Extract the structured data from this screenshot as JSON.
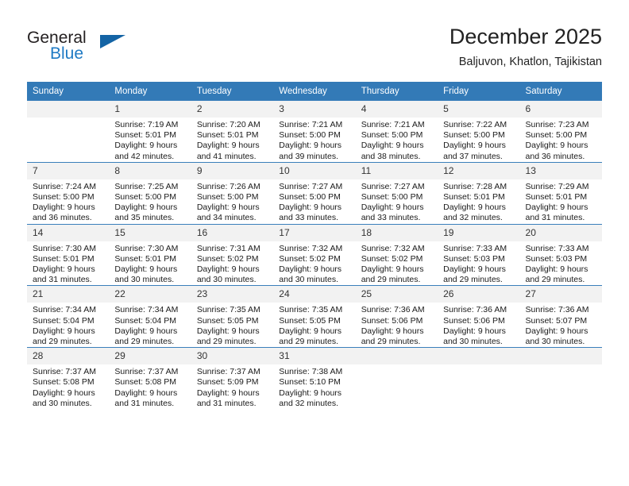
{
  "brand": {
    "name_part1": "General",
    "name_part2": "Blue",
    "logo_icon": "triangle-logo-icon",
    "color_dark": "#231f20",
    "color_blue": "#1f7ac4"
  },
  "header": {
    "title": "December 2025",
    "subtitle": "Baljuvon, Khatlon, Tajikistan"
  },
  "theme": {
    "header_row_bg": "#337ab7",
    "daynum_bg": "#f2f2f2",
    "grid_line": "#3a7fbb"
  },
  "calendar": {
    "weekdays": [
      "Sunday",
      "Monday",
      "Tuesday",
      "Wednesday",
      "Thursday",
      "Friday",
      "Saturday"
    ],
    "weeks": [
      [
        {
          "day": "",
          "sunrise": "",
          "sunset": "",
          "daylight1": "",
          "daylight2": ""
        },
        {
          "day": "1",
          "sunrise": "Sunrise: 7:19 AM",
          "sunset": "Sunset: 5:01 PM",
          "daylight1": "Daylight: 9 hours",
          "daylight2": "and 42 minutes."
        },
        {
          "day": "2",
          "sunrise": "Sunrise: 7:20 AM",
          "sunset": "Sunset: 5:01 PM",
          "daylight1": "Daylight: 9 hours",
          "daylight2": "and 41 minutes."
        },
        {
          "day": "3",
          "sunrise": "Sunrise: 7:21 AM",
          "sunset": "Sunset: 5:00 PM",
          "daylight1": "Daylight: 9 hours",
          "daylight2": "and 39 minutes."
        },
        {
          "day": "4",
          "sunrise": "Sunrise: 7:21 AM",
          "sunset": "Sunset: 5:00 PM",
          "daylight1": "Daylight: 9 hours",
          "daylight2": "and 38 minutes."
        },
        {
          "day": "5",
          "sunrise": "Sunrise: 7:22 AM",
          "sunset": "Sunset: 5:00 PM",
          "daylight1": "Daylight: 9 hours",
          "daylight2": "and 37 minutes."
        },
        {
          "day": "6",
          "sunrise": "Sunrise: 7:23 AM",
          "sunset": "Sunset: 5:00 PM",
          "daylight1": "Daylight: 9 hours",
          "daylight2": "and 36 minutes."
        }
      ],
      [
        {
          "day": "7",
          "sunrise": "Sunrise: 7:24 AM",
          "sunset": "Sunset: 5:00 PM",
          "daylight1": "Daylight: 9 hours",
          "daylight2": "and 36 minutes."
        },
        {
          "day": "8",
          "sunrise": "Sunrise: 7:25 AM",
          "sunset": "Sunset: 5:00 PM",
          "daylight1": "Daylight: 9 hours",
          "daylight2": "and 35 minutes."
        },
        {
          "day": "9",
          "sunrise": "Sunrise: 7:26 AM",
          "sunset": "Sunset: 5:00 PM",
          "daylight1": "Daylight: 9 hours",
          "daylight2": "and 34 minutes."
        },
        {
          "day": "10",
          "sunrise": "Sunrise: 7:27 AM",
          "sunset": "Sunset: 5:00 PM",
          "daylight1": "Daylight: 9 hours",
          "daylight2": "and 33 minutes."
        },
        {
          "day": "11",
          "sunrise": "Sunrise: 7:27 AM",
          "sunset": "Sunset: 5:00 PM",
          "daylight1": "Daylight: 9 hours",
          "daylight2": "and 33 minutes."
        },
        {
          "day": "12",
          "sunrise": "Sunrise: 7:28 AM",
          "sunset": "Sunset: 5:01 PM",
          "daylight1": "Daylight: 9 hours",
          "daylight2": "and 32 minutes."
        },
        {
          "day": "13",
          "sunrise": "Sunrise: 7:29 AM",
          "sunset": "Sunset: 5:01 PM",
          "daylight1": "Daylight: 9 hours",
          "daylight2": "and 31 minutes."
        }
      ],
      [
        {
          "day": "14",
          "sunrise": "Sunrise: 7:30 AM",
          "sunset": "Sunset: 5:01 PM",
          "daylight1": "Daylight: 9 hours",
          "daylight2": "and 31 minutes."
        },
        {
          "day": "15",
          "sunrise": "Sunrise: 7:30 AM",
          "sunset": "Sunset: 5:01 PM",
          "daylight1": "Daylight: 9 hours",
          "daylight2": "and 30 minutes."
        },
        {
          "day": "16",
          "sunrise": "Sunrise: 7:31 AM",
          "sunset": "Sunset: 5:02 PM",
          "daylight1": "Daylight: 9 hours",
          "daylight2": "and 30 minutes."
        },
        {
          "day": "17",
          "sunrise": "Sunrise: 7:32 AM",
          "sunset": "Sunset: 5:02 PM",
          "daylight1": "Daylight: 9 hours",
          "daylight2": "and 30 minutes."
        },
        {
          "day": "18",
          "sunrise": "Sunrise: 7:32 AM",
          "sunset": "Sunset: 5:02 PM",
          "daylight1": "Daylight: 9 hours",
          "daylight2": "and 29 minutes."
        },
        {
          "day": "19",
          "sunrise": "Sunrise: 7:33 AM",
          "sunset": "Sunset: 5:03 PM",
          "daylight1": "Daylight: 9 hours",
          "daylight2": "and 29 minutes."
        },
        {
          "day": "20",
          "sunrise": "Sunrise: 7:33 AM",
          "sunset": "Sunset: 5:03 PM",
          "daylight1": "Daylight: 9 hours",
          "daylight2": "and 29 minutes."
        }
      ],
      [
        {
          "day": "21",
          "sunrise": "Sunrise: 7:34 AM",
          "sunset": "Sunset: 5:04 PM",
          "daylight1": "Daylight: 9 hours",
          "daylight2": "and 29 minutes."
        },
        {
          "day": "22",
          "sunrise": "Sunrise: 7:34 AM",
          "sunset": "Sunset: 5:04 PM",
          "daylight1": "Daylight: 9 hours",
          "daylight2": "and 29 minutes."
        },
        {
          "day": "23",
          "sunrise": "Sunrise: 7:35 AM",
          "sunset": "Sunset: 5:05 PM",
          "daylight1": "Daylight: 9 hours",
          "daylight2": "and 29 minutes."
        },
        {
          "day": "24",
          "sunrise": "Sunrise: 7:35 AM",
          "sunset": "Sunset: 5:05 PM",
          "daylight1": "Daylight: 9 hours",
          "daylight2": "and 29 minutes."
        },
        {
          "day": "25",
          "sunrise": "Sunrise: 7:36 AM",
          "sunset": "Sunset: 5:06 PM",
          "daylight1": "Daylight: 9 hours",
          "daylight2": "and 29 minutes."
        },
        {
          "day": "26",
          "sunrise": "Sunrise: 7:36 AM",
          "sunset": "Sunset: 5:06 PM",
          "daylight1": "Daylight: 9 hours",
          "daylight2": "and 30 minutes."
        },
        {
          "day": "27",
          "sunrise": "Sunrise: 7:36 AM",
          "sunset": "Sunset: 5:07 PM",
          "daylight1": "Daylight: 9 hours",
          "daylight2": "and 30 minutes."
        }
      ],
      [
        {
          "day": "28",
          "sunrise": "Sunrise: 7:37 AM",
          "sunset": "Sunset: 5:08 PM",
          "daylight1": "Daylight: 9 hours",
          "daylight2": "and 30 minutes."
        },
        {
          "day": "29",
          "sunrise": "Sunrise: 7:37 AM",
          "sunset": "Sunset: 5:08 PM",
          "daylight1": "Daylight: 9 hours",
          "daylight2": "and 31 minutes."
        },
        {
          "day": "30",
          "sunrise": "Sunrise: 7:37 AM",
          "sunset": "Sunset: 5:09 PM",
          "daylight1": "Daylight: 9 hours",
          "daylight2": "and 31 minutes."
        },
        {
          "day": "31",
          "sunrise": "Sunrise: 7:38 AM",
          "sunset": "Sunset: 5:10 PM",
          "daylight1": "Daylight: 9 hours",
          "daylight2": "and 32 minutes."
        },
        {
          "day": "",
          "sunrise": "",
          "sunset": "",
          "daylight1": "",
          "daylight2": ""
        },
        {
          "day": "",
          "sunrise": "",
          "sunset": "",
          "daylight1": "",
          "daylight2": ""
        },
        {
          "day": "",
          "sunrise": "",
          "sunset": "",
          "daylight1": "",
          "daylight2": ""
        }
      ]
    ]
  }
}
